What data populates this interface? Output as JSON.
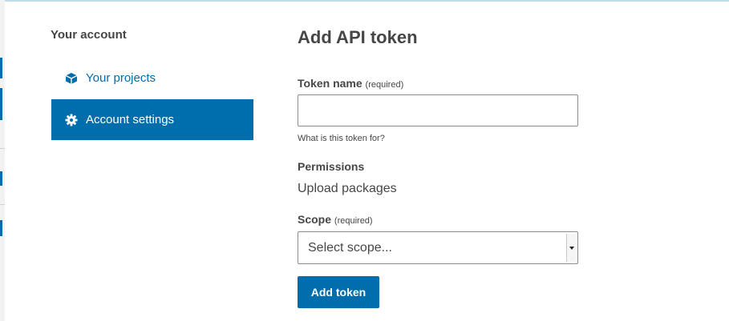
{
  "sidebar": {
    "title": "Your account",
    "items": [
      {
        "label": "Your projects",
        "icon": "cube-icon"
      },
      {
        "label": "Account settings",
        "icon": "gear-icon"
      }
    ]
  },
  "main": {
    "title": "Add API token",
    "token_name": {
      "label": "Token name",
      "required": "(required)",
      "value": "",
      "help": "What is this token for?"
    },
    "permissions": {
      "label": "Permissions",
      "value": "Upload packages"
    },
    "scope": {
      "label": "Scope",
      "required": "(required)",
      "selected": "Select scope..."
    },
    "submit_label": "Add token"
  },
  "colors": {
    "accent": "#006dad",
    "text": "#464646"
  }
}
